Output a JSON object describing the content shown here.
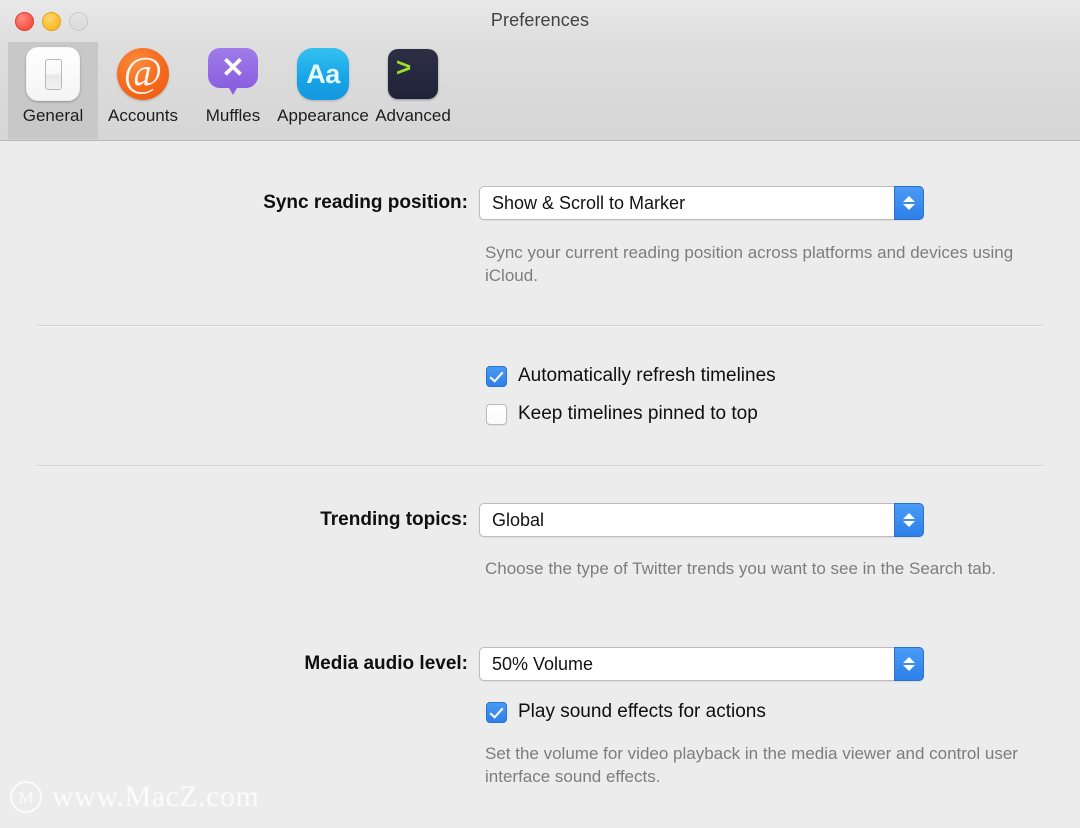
{
  "window": {
    "title": "Preferences",
    "traffic_lights": [
      {
        "name": "close",
        "color": "#f8564a"
      },
      {
        "name": "minimize",
        "color": "#fdbc2c"
      },
      {
        "name": "zoom",
        "color": "#dbdbdb"
      }
    ]
  },
  "toolbar": {
    "items": [
      {
        "label": "General",
        "icon": "light-switch-icon",
        "selected": true,
        "color": "#ffffff"
      },
      {
        "label": "Accounts",
        "icon": "at-sign-icon",
        "selected": false,
        "color": "#f4691d",
        "glyph": "@"
      },
      {
        "label": "Muffles",
        "icon": "speech-bubble-x-icon",
        "selected": false,
        "color": "#8a5fe0",
        "glyph": "✕"
      },
      {
        "label": "Appearance",
        "icon": "font-size-icon",
        "selected": false,
        "color": "#18a6e8",
        "glyph": "Aa"
      },
      {
        "label": "Advanced",
        "icon": "terminal-icon",
        "selected": false,
        "color": "#20223a",
        "glyph": ">"
      }
    ]
  },
  "general": {
    "sync_reading_position": {
      "label": "Sync reading position:",
      "value": "Show & Scroll to Marker",
      "help": "Sync your current reading position across platforms and devices using iCloud."
    },
    "timeline_options": [
      {
        "label": "Automatically refresh timelines",
        "checked": true
      },
      {
        "label": "Keep timelines pinned to top",
        "checked": false
      }
    ],
    "trending_topics": {
      "label": "Trending topics:",
      "value": "Global",
      "help": "Choose the type of Twitter trends you want to see in the Search tab."
    },
    "media_audio_level": {
      "label": "Media audio level:",
      "value": "50% Volume",
      "help": "Set the volume for video playback in the media viewer and control user interface sound effects."
    },
    "sound_effects": {
      "label": "Play sound effects for actions",
      "checked": true
    }
  },
  "watermark": {
    "logo_glyph": "M",
    "text": "www.MacZ.com"
  },
  "theme": {
    "accent": "#2e7fe8",
    "window_bg": "#ececec",
    "toolbar_bg": "#d9d9d9",
    "selected_tab_bg": "#c8c8c8"
  }
}
